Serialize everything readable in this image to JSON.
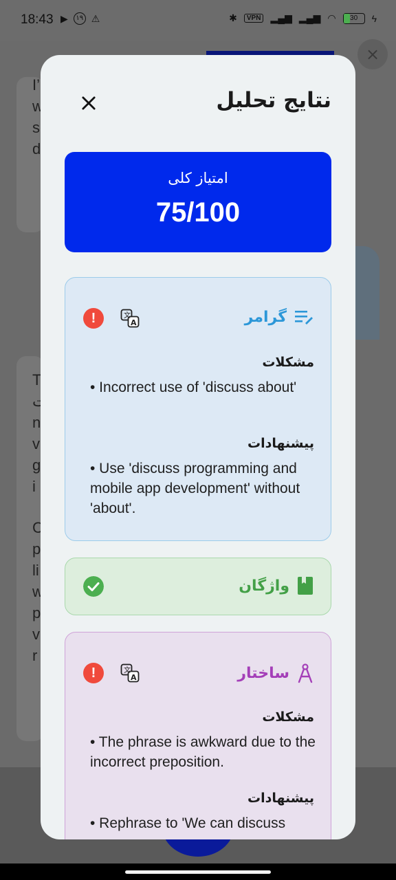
{
  "status": {
    "time": "18:43",
    "left_icons": [
      "play-icon",
      "notification-badge-icon",
      "warning-icon"
    ],
    "badge": "۱۹",
    "vpn": "VPN",
    "battery": "30"
  },
  "background": {
    "lines_a": [
      "I’",
      "w",
      "s",
      "d"
    ],
    "lines_b": [
      "T",
      "ت",
      "n",
      "v",
      "g",
      "i"
    ],
    "lines_c": [
      "C",
      "p",
      "li",
      "w",
      "p",
      "v",
      "r"
    ]
  },
  "dialog": {
    "title": "نتایج تحلیل",
    "score": {
      "label": "امتیاز کلی",
      "value": "75/100"
    },
    "grammar": {
      "title": "گرامر",
      "problems_label": "مشکلات",
      "problems": [
        "• Incorrect use of 'discuss about'"
      ],
      "suggestions_label": "پیشنهادات",
      "suggestions": [
        "• Use 'discuss programming and mobile app development' without 'about'."
      ],
      "color": "#2c97d8"
    },
    "vocabulary": {
      "title": "واژگان",
      "color": "#43a047"
    },
    "structure": {
      "title": "ساختار",
      "problems_label": "مشکلات",
      "problems": [
        "• The phrase is awkward due to the incorrect preposition."
      ],
      "suggestions_label": "پیشنهادات",
      "suggestions": [
        "• Rephrase to 'We can discuss"
      ],
      "color": "#a43fb8"
    }
  }
}
